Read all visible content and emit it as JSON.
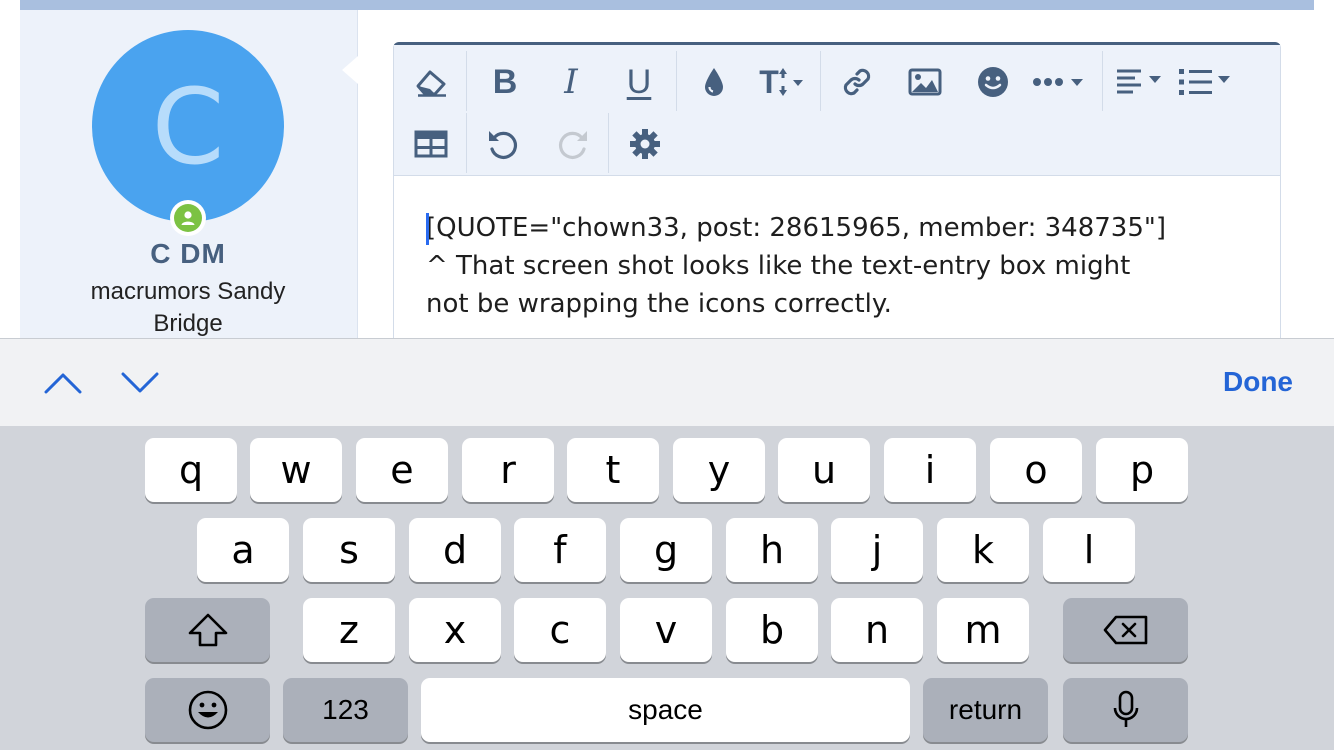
{
  "user": {
    "avatar_letter": "C",
    "name": "C DM",
    "title": "macrumors Sandy Bridge"
  },
  "editor": {
    "toolbar_icons": [
      "eraser-icon",
      "bold-icon",
      "italic-icon",
      "underline-icon",
      "color-drop-icon",
      "text-size-icon",
      "link-icon",
      "image-icon",
      "smiley-icon",
      "more-icon",
      "align-icon",
      "list-icon",
      "table-icon",
      "undo-icon",
      "redo-icon",
      "settings-icon"
    ],
    "bold_label": "B",
    "italic_label": "I",
    "underline_label": "U",
    "text_size_label": "T",
    "content_line1": "[QUOTE=\"chown33, post: 28615965, member: 348735\"]",
    "content_line2": "^ That screen shot looks like the text-entry box might",
    "content_line3": "not be wrapping the icons correctly."
  },
  "accessory": {
    "done_label": "Done"
  },
  "keyboard": {
    "row1": [
      "q",
      "w",
      "e",
      "r",
      "t",
      "y",
      "u",
      "i",
      "o",
      "p"
    ],
    "row2": [
      "a",
      "s",
      "d",
      "f",
      "g",
      "h",
      "j",
      "k",
      "l"
    ],
    "row3": [
      "z",
      "x",
      "c",
      "v",
      "b",
      "n",
      "m"
    ],
    "numbers_label": "123",
    "space_label": "space",
    "return_label": "return"
  },
  "colors": {
    "accent": "#47607f",
    "avatar": "#4aa3ef",
    "online": "#7cc243",
    "link_blue": "#2465d6"
  }
}
